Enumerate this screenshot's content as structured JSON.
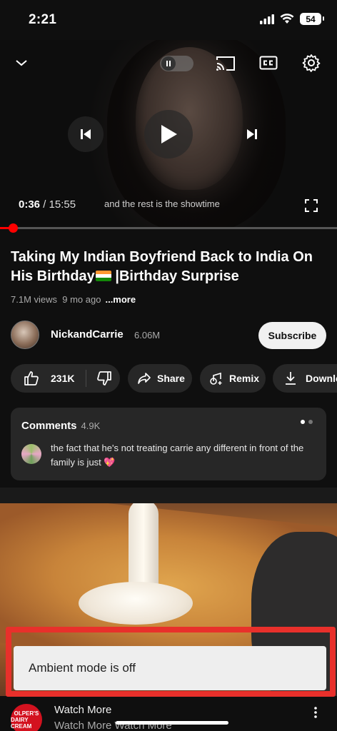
{
  "status_bar": {
    "time": "2:21",
    "battery": "54"
  },
  "player": {
    "current_time": "0:36",
    "separator": " / ",
    "duration": "15:55",
    "caption": "and the rest is the showtime",
    "progress_fraction": 0.038
  },
  "video": {
    "title_main": "Taking My Indian Boyfriend Back to India On His Birthday",
    "title_tail": " |Birthday Surprise",
    "views": "7.1M views",
    "age": "9 mo ago",
    "more": "...more"
  },
  "channel": {
    "name": "NickandCarrie",
    "subscribers": "6.06M",
    "subscribe_label": "Subscribe"
  },
  "actions": {
    "likes": "231K",
    "share": "Share",
    "remix": "Remix",
    "download": "Downlo"
  },
  "comments": {
    "header": "Comments",
    "count": "4.9K",
    "top_comment": "the fact that he's not treating carrie any different in front of the family is just"
  },
  "toast": {
    "message": "Ambient mode is off"
  },
  "ad": {
    "logo_line1": "OLPER'S",
    "logo_line2": "DAIRY CREAM",
    "title": "Watch More",
    "subtitle": "Watch More Watch More"
  },
  "colors": {
    "background": "#0f0f0f",
    "accent_red": "#ff0000",
    "pill": "#272727",
    "highlight_border": "#e8302b"
  }
}
